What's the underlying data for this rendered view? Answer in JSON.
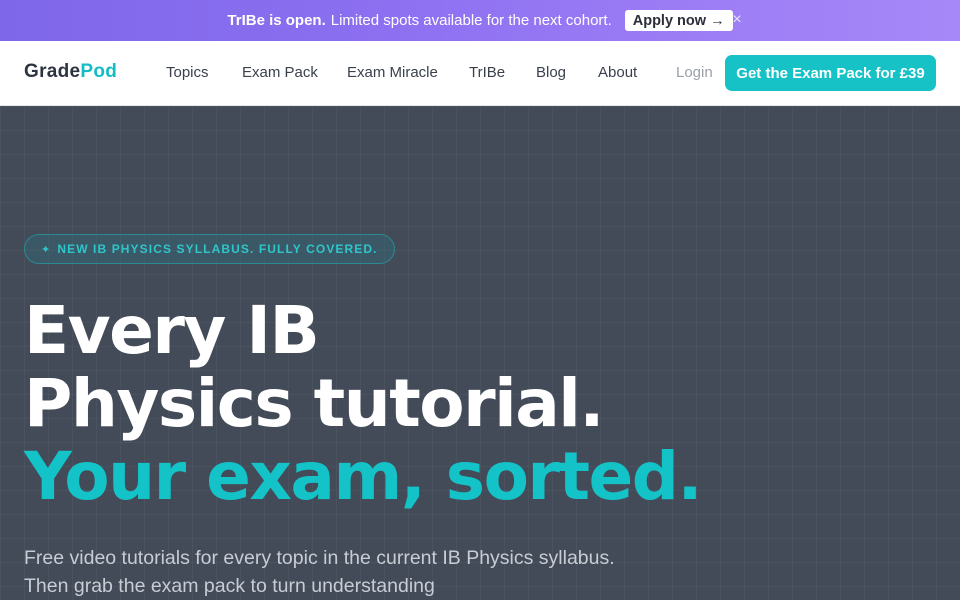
{
  "announcement": {
    "bold": "TrIBe is open.",
    "text": "Limited spots available for the next cohort.",
    "apply_label": "Apply now →",
    "close_label": "×"
  },
  "nav": {
    "logo_part1": "Grade",
    "logo_part2": "Pod",
    "links": [
      "Topics",
      "Exam Pack",
      "Exam Miracle",
      "TrIBe",
      "Blog",
      "About"
    ],
    "login": "Login",
    "cta": "Get the Exam Pack for £39"
  },
  "hero": {
    "badge_icon": "✦",
    "badge_text": "NEW IB PHYSICS SYLLABUS. FULLY COVERED.",
    "headline_line1": "Every IB",
    "headline_line2": "Physics tutorial.",
    "headline_accent": "Your exam, sorted.",
    "subtitle": "Free video tutorials for every topic in the current IB Physics syllabus. Then grab the exam pack to turn understanding"
  },
  "colors": {
    "accent": "#17c2c6",
    "announce_start": "#7f67e9",
    "announce_end": "#a788f8",
    "hero_bg": "#434b59"
  }
}
